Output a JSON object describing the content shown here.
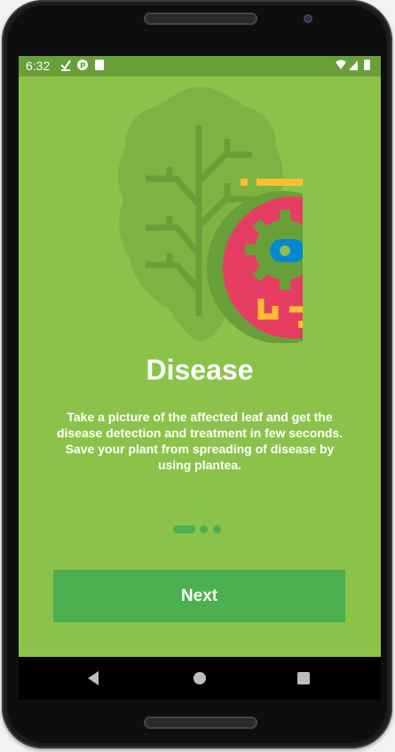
{
  "status_bar": {
    "time": "6:32"
  },
  "onboarding": {
    "title": "Disease",
    "description": "Take a picture of the affected leaf and get the disease detection and treatment in few seconds. Save your plant  from spreading of disease by using plantea.",
    "page_indicator": {
      "total": 3,
      "current": 1
    },
    "next_label": "Next"
  },
  "colors": {
    "background": "#8bc34a",
    "status_bar": "#689f38",
    "accent": "#4caf50",
    "leaf_dark": "#689f38",
    "leaf_light": "#7cb342",
    "virus": "#e63e62",
    "yellow": "#fbc02d",
    "blue": "#0288d1"
  }
}
